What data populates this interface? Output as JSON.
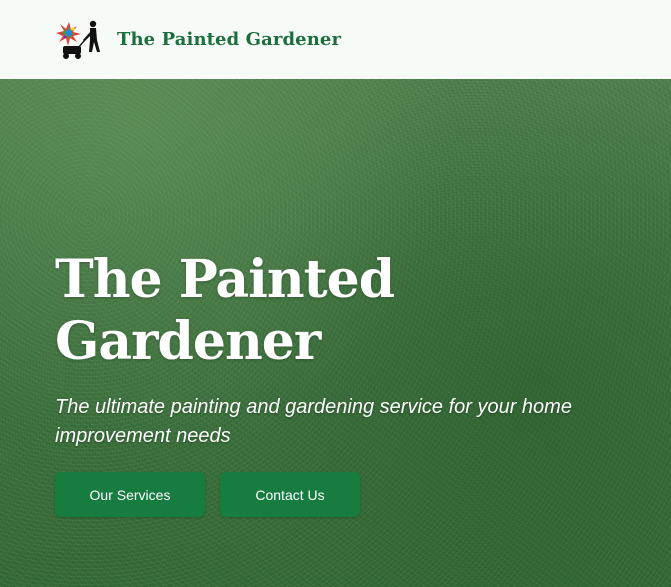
{
  "header": {
    "brand_name": "The Painted Gardener",
    "logo_icon": "gardener-with-lawnmower-and-paint-splash-icon"
  },
  "hero": {
    "title_line1": "The Painted",
    "title_line2": "Gardener",
    "subtitle": "The ultimate painting and gardening service for your home improvement needs",
    "buttons": {
      "services_label": "Our Services",
      "contact_label": "Contact Us"
    }
  },
  "colors": {
    "brand_green": "#1e6e3d",
    "button_green": "#177c3f",
    "header_bg": "#f7fbf8",
    "hero_grass": "#3f733f"
  }
}
